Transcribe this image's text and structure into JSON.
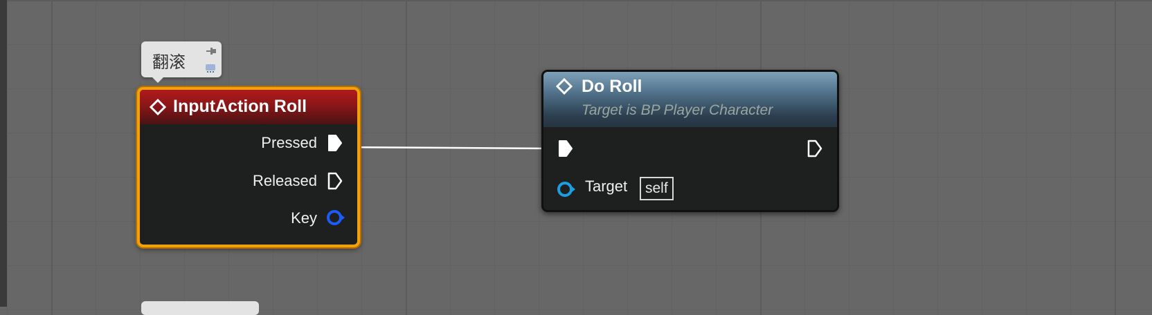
{
  "comment": {
    "text": "翻滚"
  },
  "input_node": {
    "title": "InputAction Roll",
    "pins": {
      "pressed": "Pressed",
      "released": "Released",
      "key": "Key"
    }
  },
  "roll_node": {
    "title": "Do Roll",
    "subtitle": "Target is BP Player Character",
    "target_label": "Target",
    "target_value": "self"
  },
  "colors": {
    "selection_outline": "#f0a10b",
    "event_header": "#b11a1c",
    "function_header": "#4f6f87",
    "object_pin": "#1b9fe0",
    "struct_pin": "#1a5cff",
    "exec_wire": "#ffffff"
  },
  "icons": [
    "pin-icon",
    "bubble-toggle-icon",
    "event-diamond-icon",
    "function-diamond-icon"
  ]
}
